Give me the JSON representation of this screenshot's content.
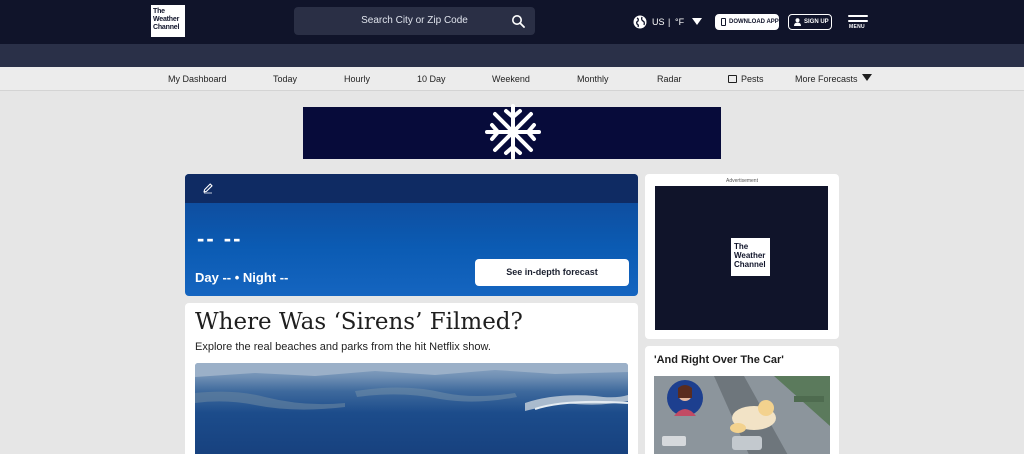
{
  "header": {
    "logo_lines": [
      "The",
      "Weather",
      "Channel"
    ],
    "search_placeholder": "Search City or Zip Code",
    "locale": "US",
    "separator": "|",
    "unit": "°F",
    "download_label": "DOWNLOAD APP",
    "signup_label": "SIGN UP",
    "menu_label": "MENU"
  },
  "nav": {
    "items": [
      "My Dashboard",
      "Today",
      "Hourly",
      "10 Day",
      "Weekend",
      "Monthly",
      "Radar",
      "Pests",
      "More Forecasts"
    ]
  },
  "weather": {
    "temperature": "-- --",
    "day_night": "Day -- • Night --",
    "forecast_button": "See in-depth forecast"
  },
  "ad": {
    "label": "Advertisement",
    "logo_lines": [
      "The",
      "Weather",
      "Channel"
    ]
  },
  "story": {
    "title": "Where Was ‘Sirens’ Filmed?",
    "subtitle": "Explore the real beaches and parks from the hit Netflix show."
  },
  "side_story": {
    "title": "'And Right Over The Car'"
  },
  "colors": {
    "header_bg": "#10142a",
    "subbar_bg": "#2a3048",
    "card_blue": "#0b5bb3",
    "banner_bg": "#070b3a"
  }
}
